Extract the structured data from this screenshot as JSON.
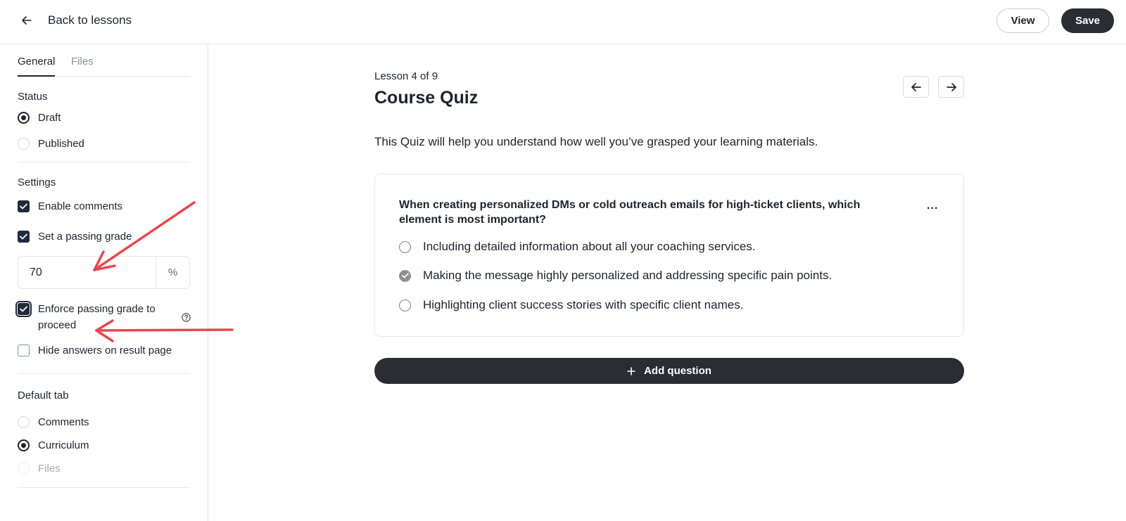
{
  "header": {
    "back_label": "Back to lessons",
    "view_label": "View",
    "save_label": "Save"
  },
  "sidebar": {
    "tabs": [
      {
        "label": "General",
        "active": true
      },
      {
        "label": "Files",
        "active": false
      }
    ],
    "status": {
      "title": "Status",
      "options": [
        {
          "label": "Draft",
          "selected": true
        },
        {
          "label": "Published",
          "selected": false
        }
      ]
    },
    "settings": {
      "title": "Settings",
      "enable_comments": {
        "label": "Enable comments",
        "checked": true
      },
      "passing_grade": {
        "label": "Set a passing grade",
        "checked": true,
        "value": "70",
        "suffix": "%"
      },
      "enforce_passing": {
        "label": "Enforce passing grade to proceed",
        "checked": true
      },
      "hide_answers": {
        "label": "Hide answers on result page",
        "checked": false
      }
    },
    "default_tab": {
      "title": "Default tab",
      "options": [
        {
          "label": "Comments",
          "selected": false,
          "disabled": false
        },
        {
          "label": "Curriculum",
          "selected": true,
          "disabled": false
        },
        {
          "label": "Files",
          "selected": false,
          "disabled": true
        }
      ]
    }
  },
  "main": {
    "lesson_count": "Lesson 4 of 9",
    "title": "Course Quiz",
    "intro": "This Quiz will help you understand how well you’ve grasped your learning materials.",
    "question": {
      "text": "When creating personalized DMs or cold outreach emails for high-ticket clients, which element is most important?",
      "more_label": "...",
      "options": [
        {
          "label": "Including detailed information about all your coaching services.",
          "correct": false
        },
        {
          "label": "Making the message highly personalized and addressing specific pain points.",
          "correct": true
        },
        {
          "label": "Highlighting client success stories with specific client names.",
          "correct": false
        }
      ]
    },
    "add_question_label": "Add question"
  },
  "colors": {
    "primary_dark": "#2a2d33",
    "annotation_red": "#e5484d",
    "border": "#e5e7eb"
  },
  "icons": [
    "arrow-left-icon",
    "arrow-right-icon",
    "help-circle-icon",
    "check-icon",
    "plus-icon"
  ]
}
